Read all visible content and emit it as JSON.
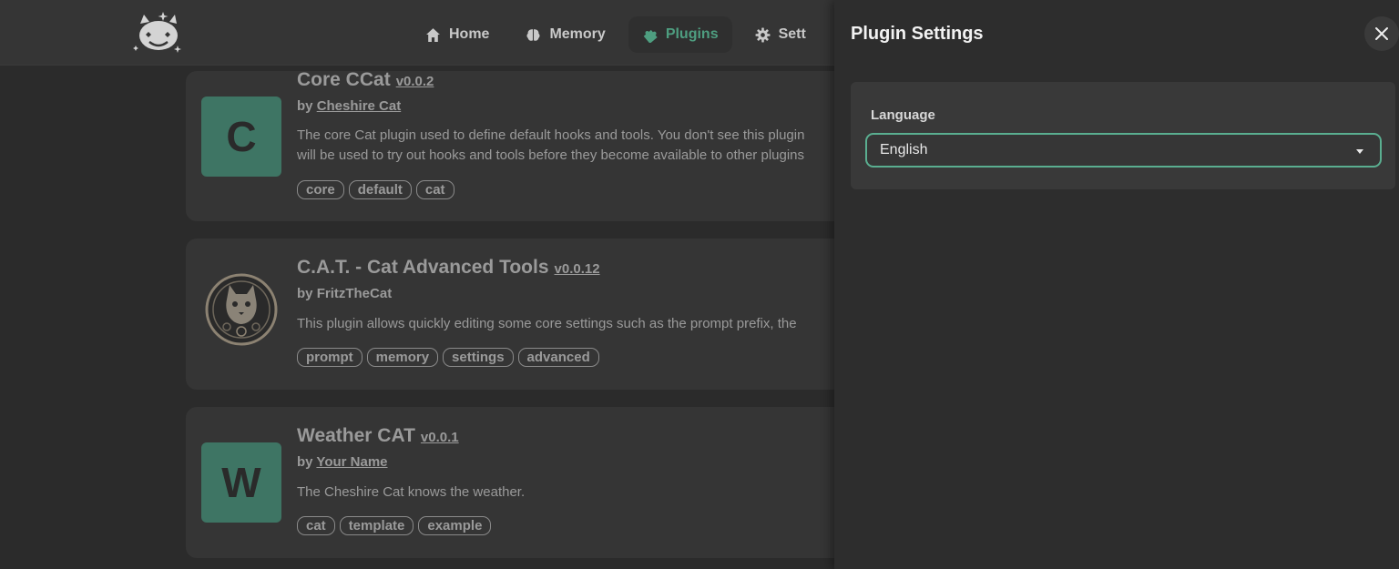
{
  "navbar": {
    "items": [
      {
        "label": "Home",
        "icon": "home-icon",
        "active": false
      },
      {
        "label": "Memory",
        "icon": "brain-icon",
        "active": false
      },
      {
        "label": "Plugins",
        "icon": "puzzle-icon",
        "active": true
      },
      {
        "label": "Sett",
        "icon": "gear-icon",
        "active": false
      }
    ],
    "accent_color": "#4e9e80"
  },
  "plugins": [
    {
      "thumb_letter": "C",
      "title": "Core CCat",
      "version": "v0.0.2",
      "by_prefix": "by",
      "author": "Cheshire Cat",
      "description_lines": [
        "The core Cat plugin used to define default hooks and tools. You don't see this plugin",
        "will be used to try out hooks and tools before they become available to other plugins"
      ],
      "tags": [
        "core",
        "default",
        "cat"
      ]
    },
    {
      "thumb_image": "cat-emblem-image",
      "title": "C.A.T. - Cat Advanced Tools",
      "version": "v0.0.12",
      "by_prefix": "by",
      "author": "FritzTheCat",
      "description_lines": [
        "This plugin allows quickly editing some core settings such as the prompt prefix, the"
      ],
      "tags": [
        "prompt",
        "memory",
        "settings",
        "advanced"
      ]
    },
    {
      "thumb_letter": "W",
      "title": "Weather CAT",
      "version": "v0.0.1",
      "by_prefix": "by",
      "author": "Your Name",
      "description_lines": [
        "The Cheshire Cat knows the weather."
      ],
      "tags": [
        "cat",
        "template",
        "example"
      ]
    }
  ],
  "panel": {
    "title": "Plugin Settings",
    "field_label": "Language",
    "select_value": "English",
    "close_icon": "close-icon"
  }
}
